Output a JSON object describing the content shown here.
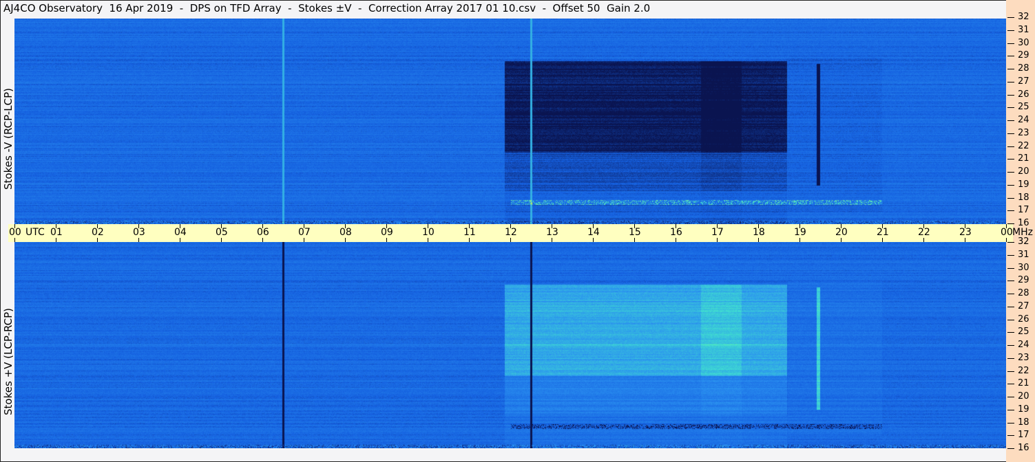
{
  "title": "AJ4CO Observatory  16 Apr 2019  -  DPS on TFD Array  -  Stokes ±V  -  Correction Array 2017 01 10.csv  -  Offset 50  Gain 2.0",
  "chart_data": {
    "type": "heatmap",
    "x_unit_label": "UTC",
    "y_unit_label": "MHz",
    "x_ticks": [
      "00",
      "01",
      "02",
      "03",
      "04",
      "05",
      "06",
      "07",
      "08",
      "09",
      "10",
      "11",
      "12",
      "13",
      "14",
      "15",
      "16",
      "17",
      "18",
      "19",
      "20",
      "21",
      "22",
      "23",
      "00"
    ],
    "y_ticks": [
      "32",
      "31",
      "30",
      "29",
      "28",
      "27",
      "26",
      "25",
      "24",
      "23",
      "22",
      "21",
      "20",
      "19",
      "18",
      "17",
      "16"
    ],
    "xlim_hours_utc": [
      0,
      24
    ],
    "ylim_mhz": [
      16,
      32
    ],
    "panels": [
      {
        "label": "Stokes -V (RCP-LCP)"
      },
      {
        "label": "Stokes +V (LCP-RCP)"
      }
    ],
    "colormap": [
      "#0a1450",
      "#1560e0",
      "#2a90f0",
      "#40e0d0",
      "#b0f060",
      "#f0f040",
      "#ff4080"
    ],
    "colors": {
      "axis_band": "#ffffc0",
      "freq_axis": "#fddcbf",
      "background": "#f4f4f6"
    }
  }
}
